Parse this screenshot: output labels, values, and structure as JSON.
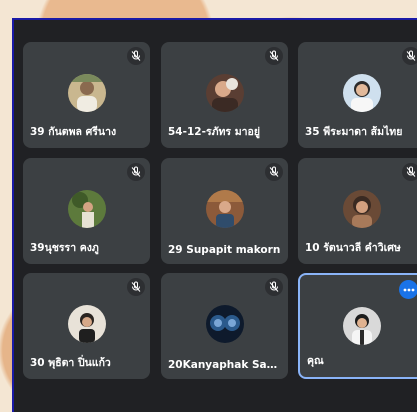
{
  "tiles": [
    {
      "name": "39 กันตพล ศรีนาง",
      "muted": true,
      "avatar_color": "#c9b78f"
    },
    {
      "name": "54-12-รภัทร มาอยู่",
      "muted": true,
      "avatar_color": "#6b4a3a"
    },
    {
      "name": "35 พีระมาดา ส้มไทย",
      "muted": true,
      "avatar_color": "#cfe0ee"
    },
    {
      "name": "39นุชรรา คงภู",
      "muted": true,
      "avatar_color": "#5d7a3c"
    },
    {
      "name": "29 Supapit makorn",
      "muted": true,
      "avatar_color": "#8c5a3a"
    },
    {
      "name": "10 รัตนาวลี คำวิเศษ",
      "muted": true,
      "avatar_color": "#7a5a40"
    },
    {
      "name": "30 พุธิตา ปิ่นแก้ว",
      "muted": true,
      "avatar_color": "#e8e2d8"
    },
    {
      "name": "20Kanyaphak San...",
      "muted": true,
      "avatar_color": "#0e1a2c"
    },
    {
      "name": "คุณ",
      "muted": false,
      "active": true,
      "avatar_color": "#d9d9d9"
    }
  ],
  "colors": {
    "tile": "#3c4043",
    "meeting_bg": "#202124",
    "active_border": "#8ab4f8",
    "more_button": "#1a73e8"
  }
}
